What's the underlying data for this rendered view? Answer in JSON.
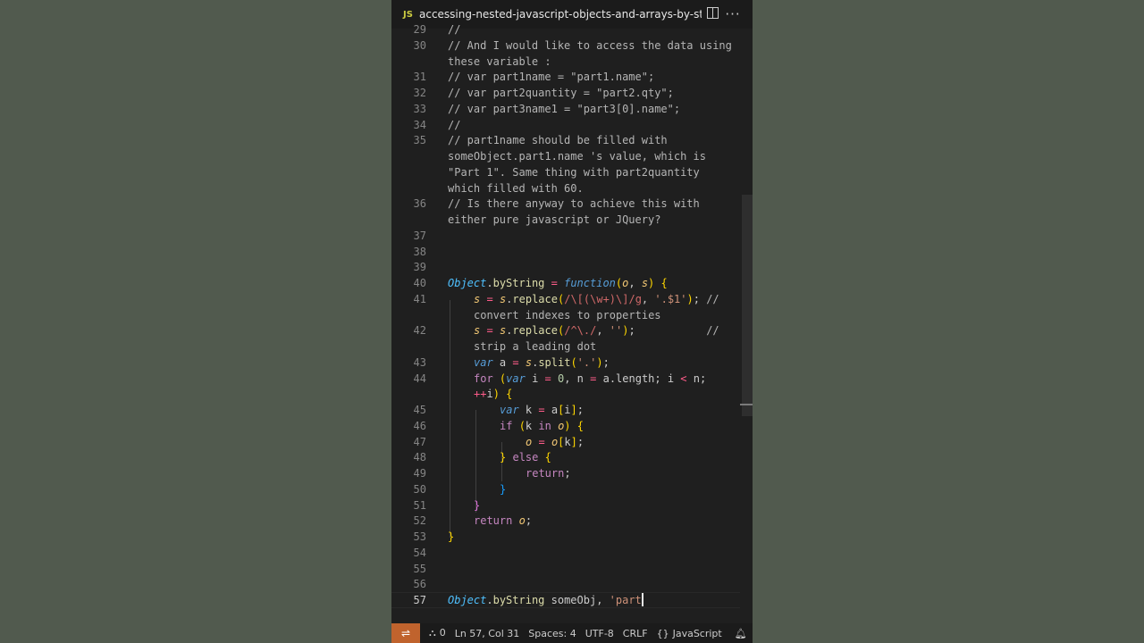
{
  "window": {
    "file_badge": "JS",
    "file_title": "accessing-nested-javascript-objects-and-arrays-by-string-p"
  },
  "editor": {
    "current_line": "57",
    "lines": [
      {
        "num": "29",
        "text": "//"
      },
      {
        "num": "30",
        "text": "// And I would like to access the data using"
      },
      {
        "num": "",
        "text": "these variable :"
      },
      {
        "num": "31",
        "text": "// var part1name = \"part1.name\";"
      },
      {
        "num": "32",
        "text": "// var part2quantity = \"part2.qty\";"
      },
      {
        "num": "33",
        "text": "// var part3name1 = \"part3[0].name\";"
      },
      {
        "num": "34",
        "text": "//"
      },
      {
        "num": "35",
        "text": "// part1name should be filled with"
      },
      {
        "num": "",
        "text": "someObject.part1.name 's value, which is"
      },
      {
        "num": "",
        "text": "\"Part 1\". Same thing with part2quantity"
      },
      {
        "num": "",
        "text": "which filled with 60."
      },
      {
        "num": "36",
        "text": "// Is there anyway to achieve this with"
      },
      {
        "num": "",
        "text": "either pure javascript or JQuery?"
      },
      {
        "num": "37",
        "text": ""
      },
      {
        "num": "38",
        "text": ""
      },
      {
        "num": "39",
        "text": ""
      },
      {
        "num": "40",
        "text": "Object.byString = function(o, s) {"
      },
      {
        "num": "41",
        "text": "s = s.replace(/\\[(\\w+)\\]/g, '.$1'); //"
      },
      {
        "num": "",
        "text": "convert indexes to properties"
      },
      {
        "num": "42",
        "text": "s = s.replace(/^\\./, '');           //"
      },
      {
        "num": "",
        "text": "strip a leading dot"
      },
      {
        "num": "43",
        "text": "var a = s.split('.');"
      },
      {
        "num": "44",
        "text": "for (var i = 0, n = a.length; i < n;"
      },
      {
        "num": "",
        "text": "++i) {"
      },
      {
        "num": "45",
        "text": "var k = a[i];"
      },
      {
        "num": "46",
        "text": "if (k in o) {"
      },
      {
        "num": "47",
        "text": "o = o[k];"
      },
      {
        "num": "48",
        "text": "} else {"
      },
      {
        "num": "49",
        "text": "return;"
      },
      {
        "num": "50",
        "text": "}"
      },
      {
        "num": "51",
        "text": "}"
      },
      {
        "num": "52",
        "text": "return o;"
      },
      {
        "num": "53",
        "text": "}"
      },
      {
        "num": "54",
        "text": ""
      },
      {
        "num": "55",
        "text": ""
      },
      {
        "num": "56",
        "text": ""
      },
      {
        "num": "57",
        "text": "Object.byString someObj, 'part"
      }
    ]
  },
  "statusbar": {
    "remote_icon": "remote-icon",
    "problems": "0",
    "position": "Ln 57, Col 31",
    "spaces": "Spaces: 4",
    "encoding": "UTF-8",
    "eol": "CRLF",
    "language": "JavaScript"
  },
  "colors": {
    "background": "#515a4e",
    "editor_bg": "#1f1f1f",
    "remote_accent": "#c0632d",
    "comment": "#b5b5b5",
    "keyword": "#c586c0",
    "string": "#ce9178"
  }
}
